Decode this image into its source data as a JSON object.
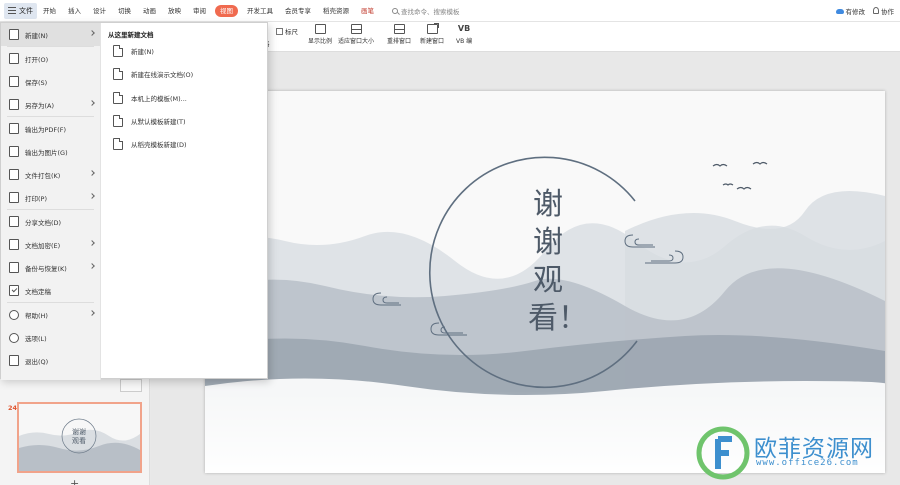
{
  "menubar": {
    "file_label": "文件",
    "tabs": [
      {
        "label": "开始",
        "active": false
      },
      {
        "label": "插入",
        "active": false
      },
      {
        "label": "设计",
        "active": false
      },
      {
        "label": "切换",
        "active": false
      },
      {
        "label": "动画",
        "active": false
      },
      {
        "label": "放映",
        "active": false
      },
      {
        "label": "审阅",
        "active": false
      },
      {
        "label": "视图",
        "active": true
      },
      {
        "label": "开发工具",
        "active": false
      },
      {
        "label": "会员专享",
        "active": false
      },
      {
        "label": "稻壳资源",
        "active": false
      },
      {
        "label": "画笔",
        "active": false
      }
    ],
    "search_placeholder": "查找命令、搜索模板",
    "save_status": "有修改",
    "collab_label": "协作"
  },
  "ribbon": {
    "ruler_label": "标尺",
    "partial_label": "格",
    "buttons": [
      {
        "label": "显示比例"
      },
      {
        "label": "适应窗口大小"
      },
      {
        "label": "重排窗口"
      },
      {
        "label": "新建窗口"
      },
      {
        "label": "VB 编"
      }
    ]
  },
  "file_menu": {
    "items": [
      {
        "label": "新建(N)",
        "icon": "new-doc-icon",
        "has_submenu": true,
        "selected": true
      },
      {
        "label": "打开(O)",
        "icon": "open-folder-icon",
        "has_submenu": false
      },
      {
        "label": "保存(S)",
        "icon": "save-icon",
        "has_submenu": false
      },
      {
        "label": "另存为(A)",
        "icon": "save-as-icon",
        "has_submenu": true
      },
      {
        "label": "输出为PDF(F)",
        "icon": "pdf-icon",
        "has_submenu": false
      },
      {
        "label": "输出为图片(G)",
        "icon": "image-icon",
        "has_submenu": false
      },
      {
        "label": "文件打包(K)",
        "icon": "package-icon",
        "has_submenu": true
      },
      {
        "label": "打印(P)",
        "icon": "print-icon",
        "has_submenu": true
      },
      {
        "label": "分享文档(D)",
        "icon": "share-icon",
        "has_submenu": false
      },
      {
        "label": "文档加密(E)",
        "icon": "lock-icon",
        "has_submenu": true
      },
      {
        "label": "备份与恢复(K)",
        "icon": "backup-icon",
        "has_submenu": true
      },
      {
        "label": "文档定稿",
        "icon": "finalize-icon",
        "has_submenu": false
      },
      {
        "label": "帮助(H)",
        "icon": "help-icon",
        "has_submenu": true
      },
      {
        "label": "选项(L)",
        "icon": "gear-icon",
        "has_submenu": false
      },
      {
        "label": "退出(Q)",
        "icon": "exit-icon",
        "has_submenu": false
      }
    ],
    "submenu_title": "从这里新建文档",
    "submenu_items": [
      {
        "label": "新建(N)",
        "icon": "new-blank-icon"
      },
      {
        "label": "新建在线演示文档(O)",
        "icon": "online-doc-icon"
      },
      {
        "label": "本机上的模板(M)...",
        "icon": "local-template-icon"
      },
      {
        "label": "从默认模板新建(T)",
        "icon": "default-template-icon"
      },
      {
        "label": "从稻壳模板新建(D)",
        "icon": "docer-template-icon"
      }
    ]
  },
  "slides": {
    "active_number": "24",
    "add_label": "+"
  },
  "slide": {
    "thanks_text": "谢谢观看！"
  },
  "watermark": {
    "title": "欧菲资源网",
    "url": "www.office26.com"
  }
}
